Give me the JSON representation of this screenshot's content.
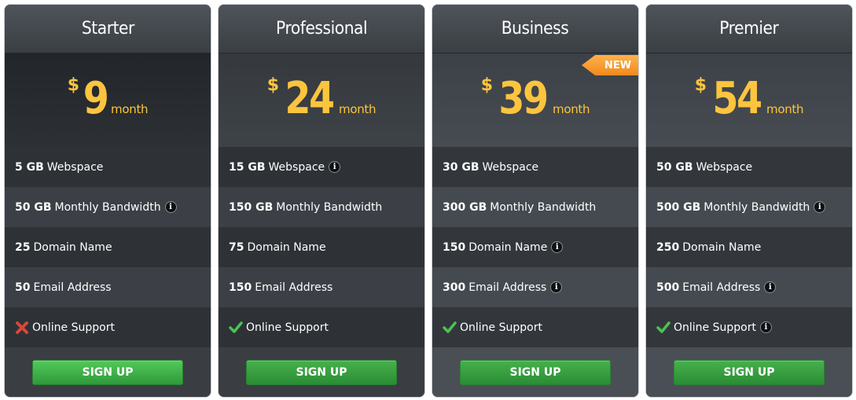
{
  "plans": [
    {
      "name": "Starter",
      "currency": "$",
      "amount": "9",
      "period": "month",
      "new_badge": "",
      "features": [
        {
          "qty": "5 GB",
          "label": "Webspace",
          "info": false
        },
        {
          "qty": "50 GB",
          "label": "Monthly Bandwidth",
          "info": true
        },
        {
          "qty": "25",
          "label": "Domain Name",
          "info": false
        },
        {
          "qty": "50",
          "label": "Email Address",
          "info": false
        },
        {
          "qty": "",
          "label": "Online Support",
          "info": false,
          "included": false
        }
      ],
      "cta": "SIGN UP"
    },
    {
      "name": "Professional",
      "currency": "$",
      "amount": "24",
      "period": "month",
      "new_badge": "",
      "features": [
        {
          "qty": "15 GB",
          "label": "Webspace",
          "info": true
        },
        {
          "qty": "150 GB",
          "label": "Monthly Bandwidth",
          "info": false
        },
        {
          "qty": "75",
          "label": "Domain Name",
          "info": false
        },
        {
          "qty": "150",
          "label": "Email Address",
          "info": false
        },
        {
          "qty": "",
          "label": "Online Support",
          "info": false,
          "included": true
        }
      ],
      "cta": "SIGN UP"
    },
    {
      "name": "Business",
      "currency": "$",
      "amount": "39",
      "period": "month",
      "new_badge": "NEW",
      "features": [
        {
          "qty": "30 GB",
          "label": "Webspace",
          "info": false
        },
        {
          "qty": "300 GB",
          "label": "Monthly Bandwidth",
          "info": false
        },
        {
          "qty": "150",
          "label": "Domain Name",
          "info": true
        },
        {
          "qty": "300",
          "label": "Email Address",
          "info": true
        },
        {
          "qty": "",
          "label": "Online Support",
          "info": false,
          "included": true
        }
      ],
      "cta": "SIGN UP"
    },
    {
      "name": "Premier",
      "currency": "$",
      "amount": "54",
      "period": "month",
      "new_badge": "",
      "features": [
        {
          "qty": "50 GB",
          "label": "Webspace",
          "info": false
        },
        {
          "qty": "500 GB",
          "label": "Monthly Bandwidth",
          "info": true
        },
        {
          "qty": "250",
          "label": "Domain Name",
          "info": false
        },
        {
          "qty": "500",
          "label": "Email Address",
          "info": true
        },
        {
          "qty": "",
          "label": "Online Support",
          "info": true,
          "included": true
        }
      ],
      "cta": "SIGN UP"
    }
  ],
  "colors": {
    "price": "#fdc43e",
    "button": "#3db247",
    "ribbon": "#f5962a",
    "check": "#4cc254",
    "cross": "#d9463a"
  },
  "icons": {
    "info": "info-icon",
    "check": "check-icon",
    "cross": "cross-icon"
  }
}
